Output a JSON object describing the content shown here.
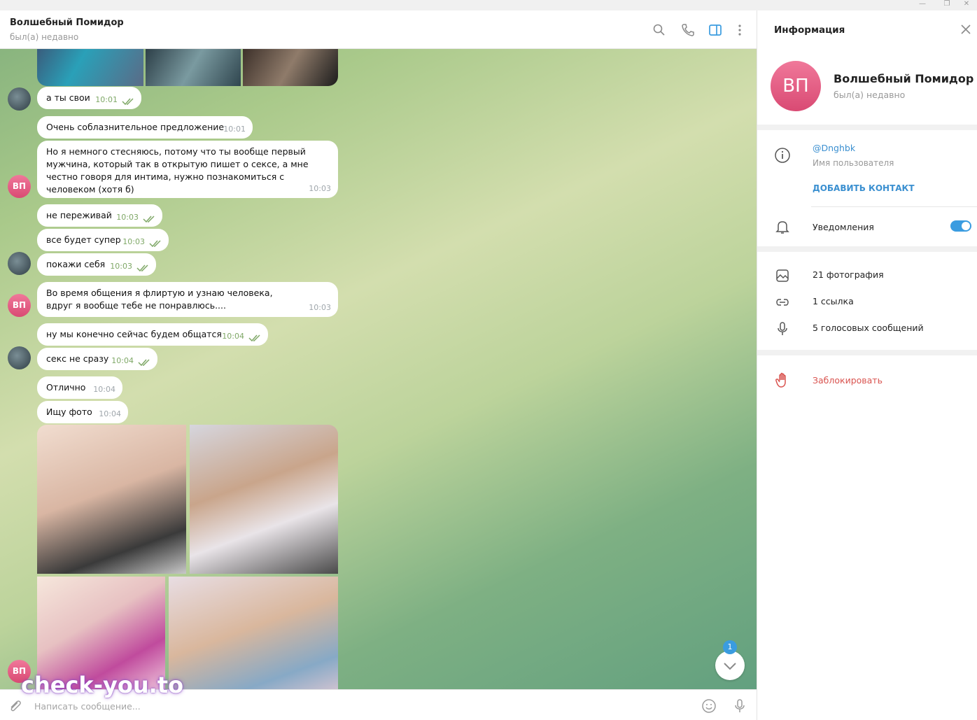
{
  "chat": {
    "title": "Волшебный Помидор",
    "status": "был(а) недавно",
    "composer_placeholder": "Написать сообщение...",
    "watermark": "check-you.to",
    "unread_count": "1",
    "messages": [
      {
        "text": "а ты свои",
        "time": "10:01",
        "dir": "out"
      },
      {
        "text": "Очень соблазнительное предложение",
        "time": "10:01",
        "dir": "in"
      },
      {
        "text": "Но я немного стесняюсь, потому что ты вообще первый мужчина, который так в открытую пишет о сексе, а мне честно говоря для интима, нужно познакомиться с человеком (хотя б)",
        "time": "10:03",
        "dir": "in"
      },
      {
        "text": "не переживай",
        "time": "10:03",
        "dir": "out"
      },
      {
        "text": "все будет супер",
        "time": "10:03",
        "dir": "out"
      },
      {
        "text": "покажи себя",
        "time": "10:03",
        "dir": "out"
      },
      {
        "text": "Во время общения я флиртую и узнаю человека, вдруг я вообще тебе не понравлюсь....",
        "time": "10:03",
        "dir": "in"
      },
      {
        "text": "ну мы конечно сейчас будем общатся",
        "time": "10:04",
        "dir": "out"
      },
      {
        "text": "секс не сразу",
        "time": "10:04",
        "dir": "out"
      },
      {
        "text": "Отлично",
        "time": "10:04",
        "dir": "in"
      },
      {
        "text": "Ищу фото",
        "time": "10:04",
        "dir": "in"
      }
    ],
    "avatar_initials": "ВП"
  },
  "panel": {
    "title": "Информация",
    "name": "Волшебный Помидор",
    "status": "был(а) недавно",
    "avatar_initials": "ВП",
    "username": "@Dnghbk",
    "username_label": "Имя пользователя",
    "add_contact": "ДОБАВИТЬ КОНТАКТ",
    "notifications": "Уведомления",
    "notifications_on": true,
    "photos": "21 фотография",
    "links": "1 ссылка",
    "voice": "5 голосовых сообщений",
    "block": "Заблокировать"
  },
  "colors": {
    "accent": "#3a9ce0",
    "danger": "#d9534f",
    "avatar": "#e35d83"
  }
}
